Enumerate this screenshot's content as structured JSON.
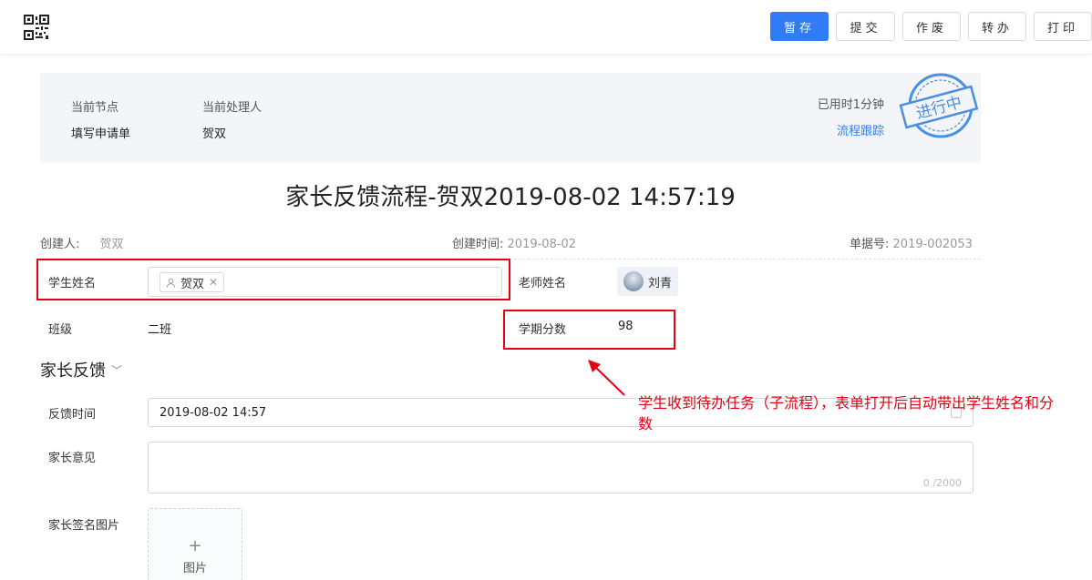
{
  "toolbar": {
    "save_draft": "暂存",
    "submit": "提交",
    "void": "作废",
    "transfer": "转办",
    "print": "打印"
  },
  "status": {
    "current_node_label": "当前节点",
    "current_node_value": "填写申请单",
    "handler_label": "当前处理人",
    "handler_value": "贺双",
    "elapsed": "已用时1分钟",
    "trace_link": "流程跟踪",
    "stamp_text": "进行中"
  },
  "page_title": "家长反馈流程-贺双2019-08-02 14:57:19",
  "meta": {
    "creator_label": "创建人:",
    "creator_value": "贺双",
    "created_time_label": "创建时间:",
    "created_time_value": "2019-08-02",
    "doc_no_label": "单据号:",
    "doc_no_value": "2019-002053"
  },
  "form": {
    "student_name_label": "学生姓名",
    "student_name_tag": "贺双",
    "teacher_name_label": "老师姓名",
    "teacher_name_value": "刘青",
    "class_label": "班级",
    "class_value": "二班",
    "term_score_label": "学期分数",
    "term_score_value": "98"
  },
  "section": {
    "title": "家长反馈"
  },
  "feedback": {
    "time_label": "反馈时间",
    "time_value": "2019-08-02 14:57",
    "opinion_label": "家长意见",
    "opinion_counter": "0 /2000",
    "signature_label": "家长签名图片",
    "upload_label": "图片"
  },
  "annotation": {
    "text": "学生收到待办任务（子流程），表单打开后自动带出学生姓名和分数",
    "color": "#e60012"
  },
  "colors": {
    "primary": "#2f7cf6",
    "highlight": "#e60012"
  }
}
